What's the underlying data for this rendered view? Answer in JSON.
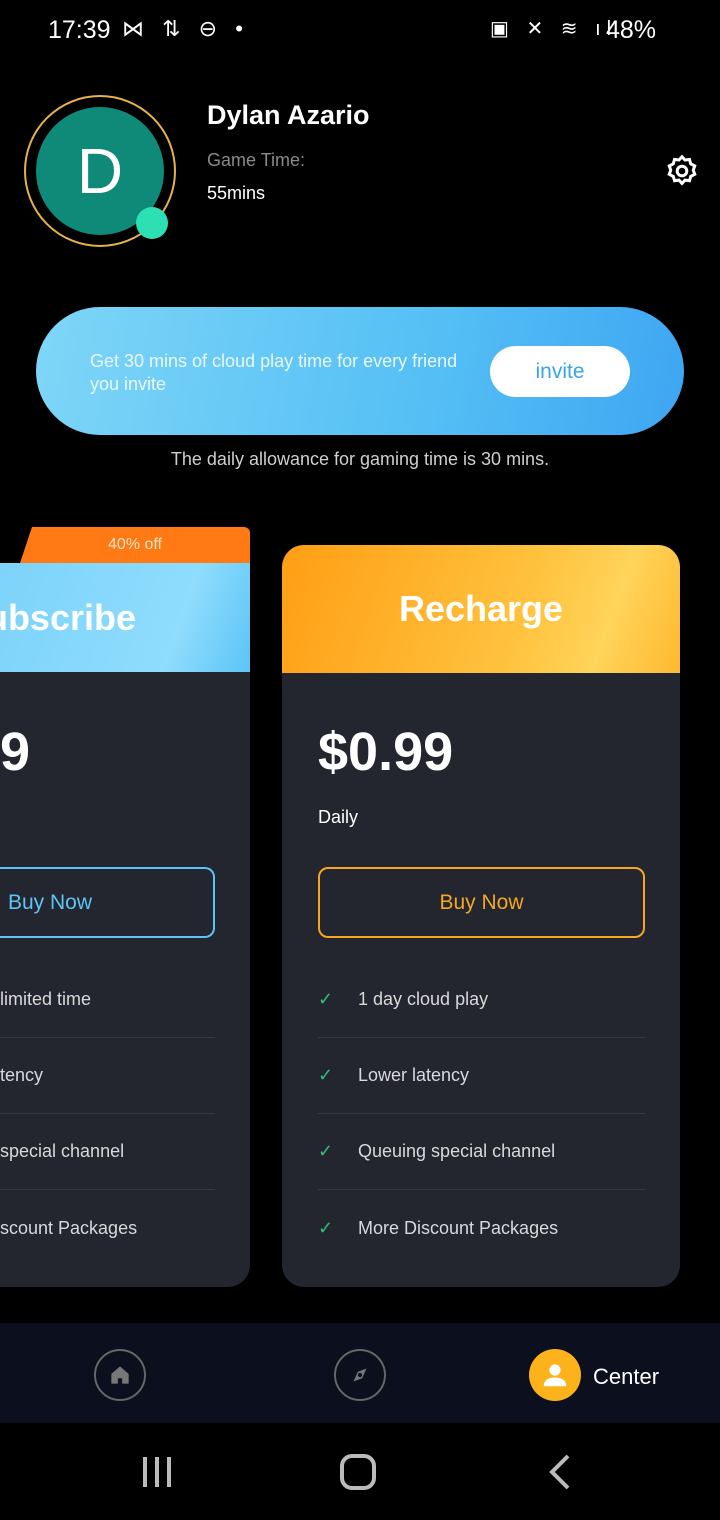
{
  "status_bar": {
    "time": "17:39",
    "battery": "48%",
    "left_icons": [
      "gallery-icon",
      "data-transfer-icon",
      "dnd-icon",
      "dot-icon"
    ],
    "right_icons": [
      "battery-saver-icon",
      "mute-icon",
      "wifi-icon",
      "signal-icon",
      "battery-icon"
    ]
  },
  "profile": {
    "initial": "D",
    "name": "Dylan Azario",
    "game_time_label": "Game Time:",
    "game_time_value": "55mins",
    "avatar_color": "#0f8a78",
    "online_color": "#2de0b4"
  },
  "banner": {
    "text": "Get 30 mins of cloud play time for every friend you invite",
    "button": "invite"
  },
  "allowance": "The daily allowance for gaming time is 30 mins.",
  "plans": [
    {
      "title": "Subscribe",
      "visible_title": "ubscribe",
      "badge": "40% off",
      "price_visible": "9",
      "button": "Buy Now",
      "accent": "#5cc4f6",
      "features": [
        "limited time",
        "tency",
        "special channel",
        "scount Packages"
      ]
    },
    {
      "title": "Recharge",
      "price": "$0.99",
      "period": "Daily",
      "button": "Buy Now",
      "accent": "#f5a623",
      "features": [
        "1 day cloud play",
        "Lower latency",
        "Queuing special channel",
        "More Discount Packages"
      ]
    }
  ],
  "tabbar": {
    "items": [
      {
        "icon": "home-icon"
      },
      {
        "icon": "compass-icon"
      },
      {
        "icon": "user-icon",
        "label": "Center",
        "active": true
      }
    ]
  }
}
